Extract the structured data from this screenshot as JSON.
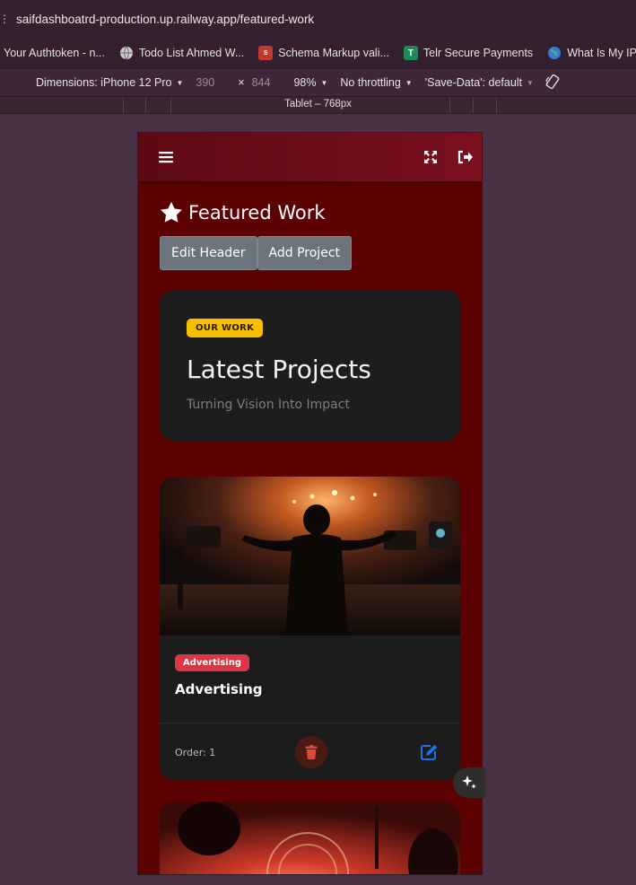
{
  "browser": {
    "url": "saifdashboatrd-production.up.railway.app/featured-work",
    "bookmarks": [
      {
        "label": "Your Authtoken - n...",
        "icon": "ngrok-icon"
      },
      {
        "label": "Todo List Ahmed W...",
        "icon": "globe-icon"
      },
      {
        "label": "Schema Markup vali...",
        "icon": "schema-icon"
      },
      {
        "label": "Telr Secure Payments",
        "icon": "telr-icon"
      },
      {
        "label": "What Is My IP Add",
        "icon": "globe-color-icon"
      }
    ]
  },
  "devtools": {
    "dimensions_label": "Dimensions: iPhone 12 Pro",
    "width": "390",
    "times": "×",
    "height": "844",
    "zoom": "98%",
    "throttle": "No throttling",
    "save_data": "'Save-Data': default",
    "ruler_label": "Tablet – 768px"
  },
  "app": {
    "page_title": "Featured Work",
    "buttons": {
      "edit_header": "Edit Header",
      "add_project": "Add Project"
    },
    "hero": {
      "badge": "OUR WORK",
      "title": "Latest Projects",
      "subtitle": "Turning Vision Into Impact"
    },
    "projects": [
      {
        "badge": "Advertising",
        "title": "Advertising",
        "order_label": "Order: 1"
      }
    ],
    "colors": {
      "background": "#5c0202",
      "card": "#1c1c1c",
      "badge_yellow": "#f6c000",
      "badge_red": "#dc3545",
      "edit_blue": "#1a73e8",
      "delete_red": "#e0483a"
    }
  }
}
